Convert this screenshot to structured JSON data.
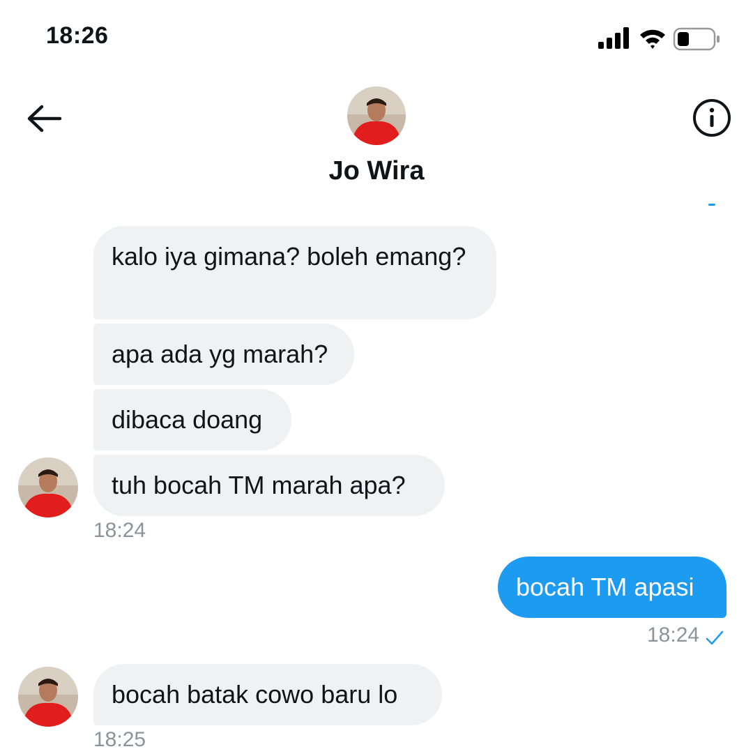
{
  "status_bar": {
    "time": "18:26",
    "icons": [
      "signal-icon",
      "wifi-icon",
      "battery-icon"
    ]
  },
  "header": {
    "back_icon": "arrow-left-icon",
    "info_icon": "info-icon",
    "contact_name": "Jo Wira"
  },
  "messages": {
    "group1": [
      {
        "text": "kalo iya gimana? boleh emang?"
      },
      {
        "text": "apa ada yg marah?"
      },
      {
        "text": "dibaca doang"
      },
      {
        "text": "tuh bocah TM marah apa?"
      }
    ],
    "group1_time": "18:24",
    "outgoing": {
      "text": "bocah TM apasi"
    },
    "outgoing_time": "18:24",
    "group2": [
      {
        "text": "bocah batak cowo baru lo"
      }
    ],
    "group2_time": "18:25"
  },
  "colors": {
    "accent": "#1d9bf0",
    "incoming_bubble": "#eff1f3",
    "timestamp": "#8a949c"
  }
}
